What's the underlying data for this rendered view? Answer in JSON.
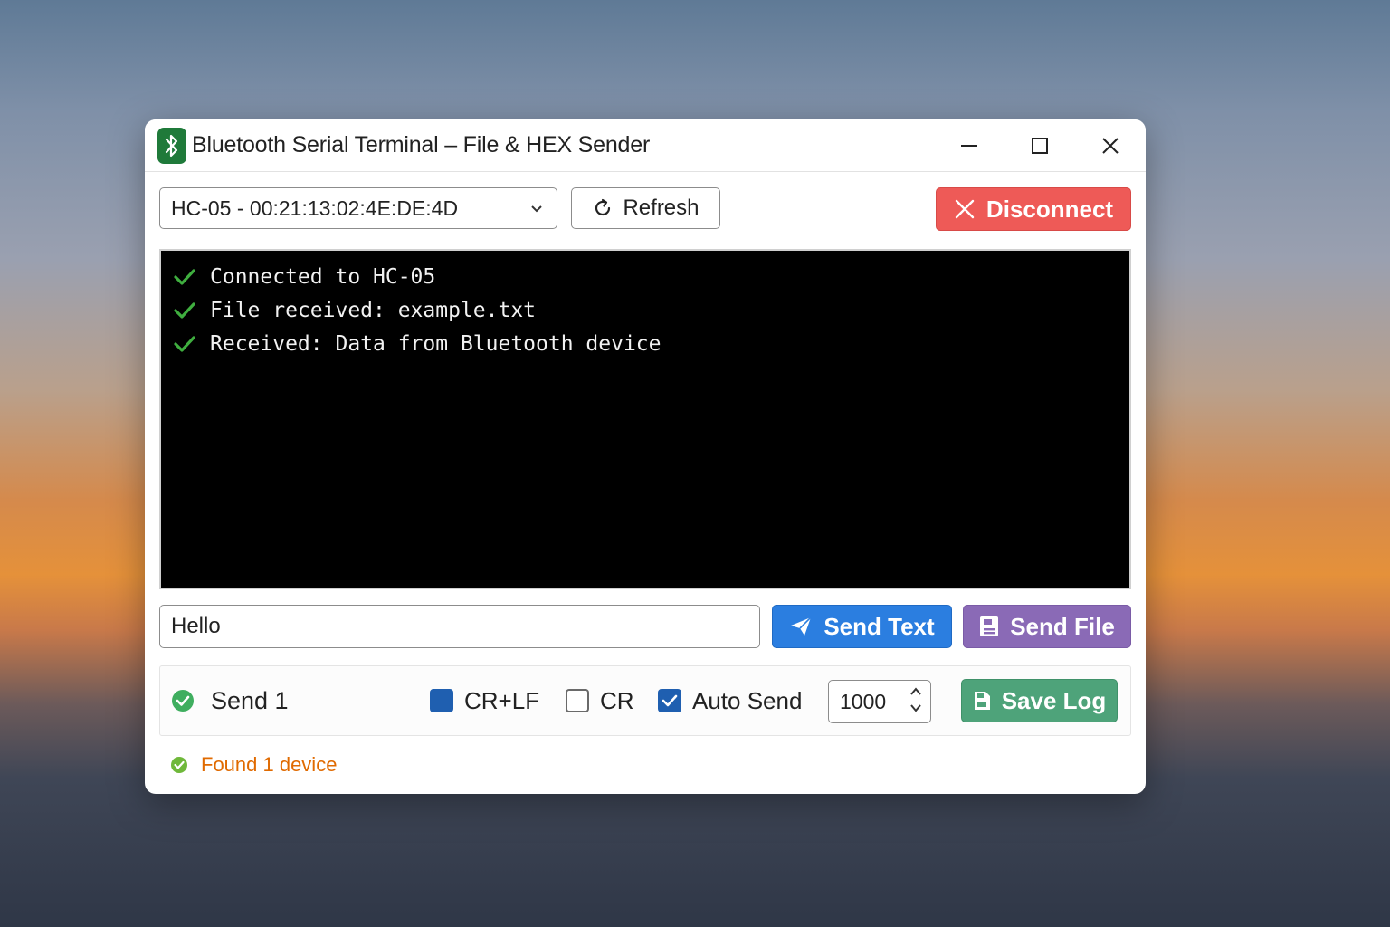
{
  "window": {
    "title": "Bluetooth Serial Terminal – File & HEX Sender"
  },
  "toolbar": {
    "device_selected": "HC-05 - 00:21:13:02:4E:DE:4D",
    "refresh_label": "Refresh",
    "disconnect_label": "Disconnect"
  },
  "terminal": {
    "lines": [
      "Connected to HC-05",
      "File received: example.txt",
      "Received: Data from Bluetooth device"
    ]
  },
  "send": {
    "input_value": "Hello",
    "send_text_label": "Send Text",
    "send_file_label": "Send File"
  },
  "options": {
    "send_status_label": "Send 1",
    "crlf_label": "CR+LF",
    "crlf_checked": true,
    "cr_label": "CR",
    "cr_checked": false,
    "auto_send_label": "Auto Send",
    "auto_send_checked": true,
    "interval_value": "1000",
    "save_log_label": "Save Log"
  },
  "status": {
    "text": "Found 1 device"
  },
  "colors": {
    "disconnect": "#ee5a57",
    "send_text": "#2b7ee0",
    "send_file": "#8a6ab6",
    "save_log": "#4ea37a",
    "status_text": "#e06a00",
    "check_green": "#3fae3f",
    "app_icon": "#1f7a3a"
  },
  "icons": {
    "app": "bluetooth-icon",
    "refresh": "refresh-icon",
    "disconnect": "close-icon",
    "send_text": "paper-plane-icon",
    "send_file": "file-icon",
    "save_log": "save-icon",
    "terminal_check": "check-icon",
    "status": "check-circle-icon"
  }
}
